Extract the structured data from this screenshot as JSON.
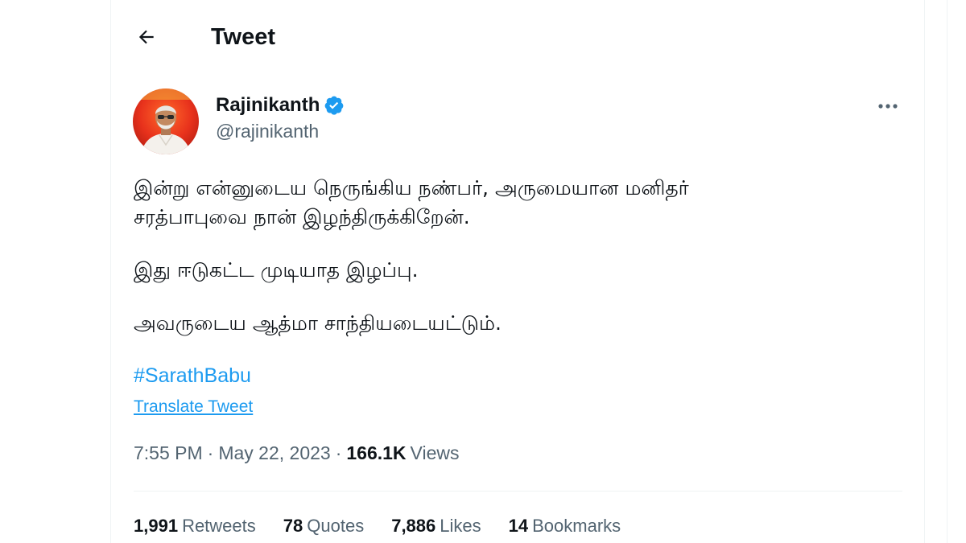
{
  "header": {
    "title": "Tweet",
    "back_icon": "arrow-left-icon"
  },
  "author": {
    "name": "Rajinikanth",
    "handle": "@rajinikanth",
    "verified": true,
    "verified_icon": "verified-badge-icon",
    "avatar_icon": "avatar-photo"
  },
  "tweet": {
    "lines": [
      "இன்று என்னுடைய நெருங்கிய நண்பர், அருமையான மனிதர்",
      "சரத்பாபுவை நான் இழந்திருக்கிறேன்.",
      "இது ஈடுகட்ட முடியாத இழப்பு.",
      "அவருடைய ஆத்மா சாந்தியடையட்டும்."
    ],
    "hashtag": "#SarathBabu",
    "translate_label": "Translate Tweet"
  },
  "meta": {
    "time": "7:55 PM",
    "separator": "·",
    "date": "May 22, 2023",
    "views_count": "166.1K",
    "views_label": "Views"
  },
  "stats": {
    "retweets_count": "1,991",
    "retweets_label": "Retweets",
    "quotes_count": "78",
    "quotes_label": "Quotes",
    "likes_count": "7,886",
    "likes_label": "Likes",
    "bookmarks_count": "14",
    "bookmarks_label": "Bookmarks"
  },
  "colors": {
    "accent": "#1d9bf0",
    "text_primary": "#0f1419",
    "text_secondary": "#536471",
    "divider": "#eff3f4"
  },
  "more_icon": "more-horizontal-icon"
}
